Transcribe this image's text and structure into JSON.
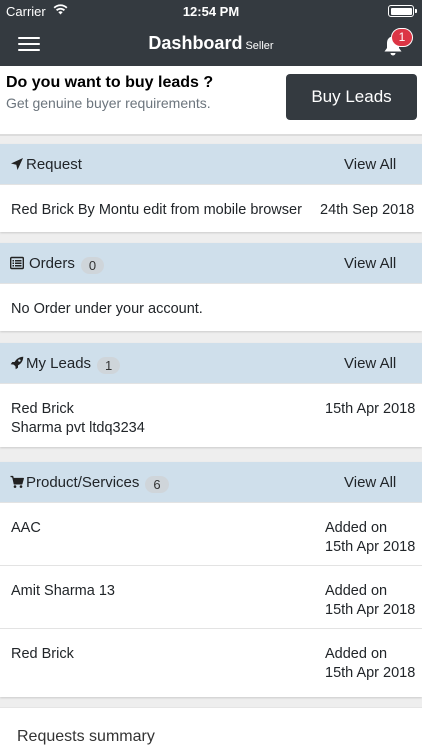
{
  "status_bar": {
    "carrier": "Carrier",
    "time": "12:54 PM"
  },
  "navbar": {
    "title": "Dashboard",
    "subtitle": "Seller",
    "notification_count": "1"
  },
  "buy_leads": {
    "title": "Do you want to buy leads ?",
    "subtitle": "Get genuine buyer requirements.",
    "button_label": "Buy Leads"
  },
  "request": {
    "label": "Request",
    "view_all": "View All",
    "items": [
      {
        "name": "Red Brick By Montu edit from mobile browser",
        "date": "24th Sep 2018"
      }
    ]
  },
  "orders": {
    "label": "Orders",
    "count": "0",
    "view_all": "View All",
    "empty_text": "No Order under your account."
  },
  "my_leads": {
    "label": "My Leads",
    "count": "1",
    "view_all": "View All",
    "items": [
      {
        "name": "Red Brick",
        "company": "Sharma pvt ltdq3234",
        "date": "15th Apr 2018"
      }
    ]
  },
  "products": {
    "label": "Product/Services",
    "count": "6",
    "view_all": "View All",
    "items": [
      {
        "name": "AAC",
        "added_label": "Added on",
        "date": "15th Apr 2018"
      },
      {
        "name": "Amit Sharma 13",
        "added_label": "Added on",
        "date": "15th Apr 2018"
      },
      {
        "name": "Red Brick",
        "added_label": "Added on",
        "date": "15th Apr 2018"
      }
    ]
  },
  "requests_summary": {
    "title": "Requests summary"
  },
  "colors": {
    "nav": "#343a40",
    "section_header": "#cfdfeb",
    "badge": "#dc3545"
  },
  "icons": {
    "request": "location-arrow-icon",
    "orders": "list-alt-icon",
    "my_leads": "rocket-icon",
    "products": "shopping-cart-icon",
    "notifications": "bell-icon",
    "menu": "hamburger-menu-icon"
  }
}
